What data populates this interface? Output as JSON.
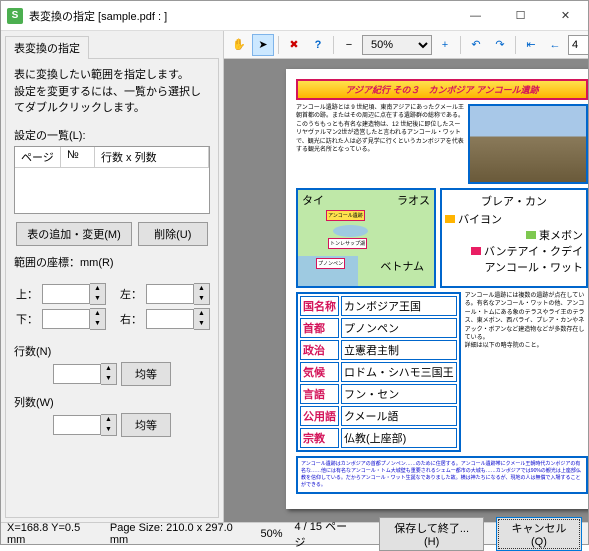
{
  "window": {
    "title": "表変換の指定 [sample.pdf : ]",
    "appicon": "S"
  },
  "winbtns": {
    "min": "—",
    "max": "☐",
    "close": "✕"
  },
  "tab": "表変換の指定",
  "desc": "表に変換したい範囲を指定します。\n設定を変更するには、一覧から選択してダブルクリックします。",
  "settings_label": "設定の一覧(L):",
  "list_headers": {
    "page": "ページ",
    "num": "№",
    "rc": "行数 x 列数"
  },
  "buttons": {
    "add": "表の追加・変更(M)",
    "del": "削除(U)",
    "even": "均等",
    "save": "保存して終了...(H)",
    "cancel": "キャンセル(Q)"
  },
  "coord": {
    "label": "範囲の座標：mm(R)",
    "top": "上：",
    "left": "左：",
    "bottom": "下：",
    "right": "右："
  },
  "rows": {
    "label": "行数(N)"
  },
  "cols": {
    "label": "列数(W)"
  },
  "toolbar": {
    "zoom": "50%",
    "page": "4"
  },
  "status": {
    "xy": "X=168.8 Y=0.5 mm",
    "pagesize": "Page Size: 210.0 x 297.0 mm",
    "zoom": "50%",
    "pages": "4 / 15 ページ"
  },
  "doc": {
    "title": "アジア紀行 その３　カンボジア アンコール遺跡",
    "para1": "アンコール遺跡とは 9 世紀頃、東南アジアにあったクメール王朝首都の跡。またはその周辺に点在する遺跡群の総称である。このうちもっとも有名な建造物は、12 世紀後に即位したスーリヤヴァルマン2世が造営したと言われるアンコール・ワットで、観光に訪れた人は必ず見学に行くというカンボジアを代表する観光名所となっている。",
    "map": {
      "thai": "タイ",
      "laos": "ラオス",
      "viet": "ベトナム",
      "pp": "プノンペン",
      "ankor": "アンコール遺跡",
      "lake": "トンレサップ湖"
    },
    "legend": {
      "h": "ブレア・カン",
      "items": [
        "バイヨン",
        "東メボン",
        "バンテアイ・クデイ",
        "アンコール・ワット"
      ]
    },
    "table": [
      [
        "国名称",
        "カンボジア王国"
      ],
      [
        "首都",
        "プノンペン"
      ],
      [
        "政治",
        "立憲君主制"
      ],
      [
        "気候",
        "ロドム・シハモ三国王"
      ],
      [
        "言語",
        "フン・セン"
      ],
      [
        "公用語",
        "クメール語"
      ],
      [
        "宗教",
        "仏教(上座部)"
      ]
    ],
    "para2": "アンコール遺跡には複数の遺跡が点在している。有名なアンコール・ワットの他、アンコール・トムにある象のテラスやライ王のテラス、東メボン、西バライ、プレア・カンやネアック・ボアンなど建造物などが多数存在している。\n詳細は以下の略寺院のこと。",
    "footer": "アンコール遺跡はカンボジアの首都プノンペン……のために住居する。アンコール遺跡帯にクメール王朝時代カンボジアの有名な……他には有名なアンコール・トム大城壁も重要されるシェムー都市の大城も……カンボジアでは90%の観光は上座部仏教を信仰している。だからアンコール・ワット生誕なでありました故。横は神たちになるが、現地の人は無償で入場することができる。"
  }
}
